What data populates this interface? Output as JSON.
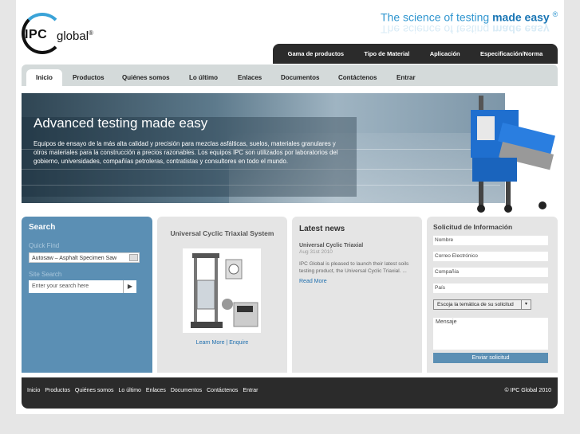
{
  "logo": {
    "ipc": "IPC",
    "global": "global",
    "reg": "®"
  },
  "tagline": {
    "prefix": "The science of testing ",
    "bold": "made easy",
    "reg": "®"
  },
  "top_nav": [
    "Gama de productos",
    "Tipo de Material",
    "Aplicación",
    "Especificación/Norma"
  ],
  "main_nav": [
    "Inicio",
    "Productos",
    "Quiénes somos",
    "Lo último",
    "Enlaces",
    "Documentos",
    "Contáctenos",
    "Entrar"
  ],
  "hero": {
    "title": "Advanced testing made easy",
    "text": "Equipos de ensayo de la más alta calidad y precisión para mezclas asfálticas, suelos, materiales granulares y otros materiales para la construcción a precios razonables. Los equipos IPC son utilizados por laboratorios del gobierno, universidades, compañías petroleras, contratistas y consultores en todo el mundo."
  },
  "search": {
    "title": "Search",
    "quick_find_label": "Quick Find",
    "quick_find_value": "Autosaw – Asphalt Specimen Saw",
    "site_search_label": "Site Search",
    "site_search_placeholder": "Enter your search here",
    "go": "▶"
  },
  "product": {
    "title": "Universal Cyclic Triaxial System",
    "learn_more": "Learn More",
    "sep": " | ",
    "enquire": "Enquire"
  },
  "news": {
    "title": "Latest news",
    "item_title": "Universal Cyclic Triaxial",
    "item_date": "Aug 31st 2010",
    "item_text": "IPC Global is pleased to launch their latest soils testing product, the Universal Cyclic Triaxial. ...",
    "read_more": "Read More"
  },
  "request": {
    "title": "Solicitud de Información",
    "fields": [
      "Nombre",
      "Correo Electrónico",
      "Compañía",
      "País"
    ],
    "topic": "Escoja la temática de su solicitud",
    "message": "Mensaje",
    "send": "Enviar solicitud"
  },
  "footer": {
    "links": [
      "Inicio",
      "Productos",
      "Quiénes somos",
      "Lo último",
      "Enlaces",
      "Documentos",
      "Contáctenos",
      "Entrar"
    ],
    "copyright": "© IPC Global 2010"
  }
}
